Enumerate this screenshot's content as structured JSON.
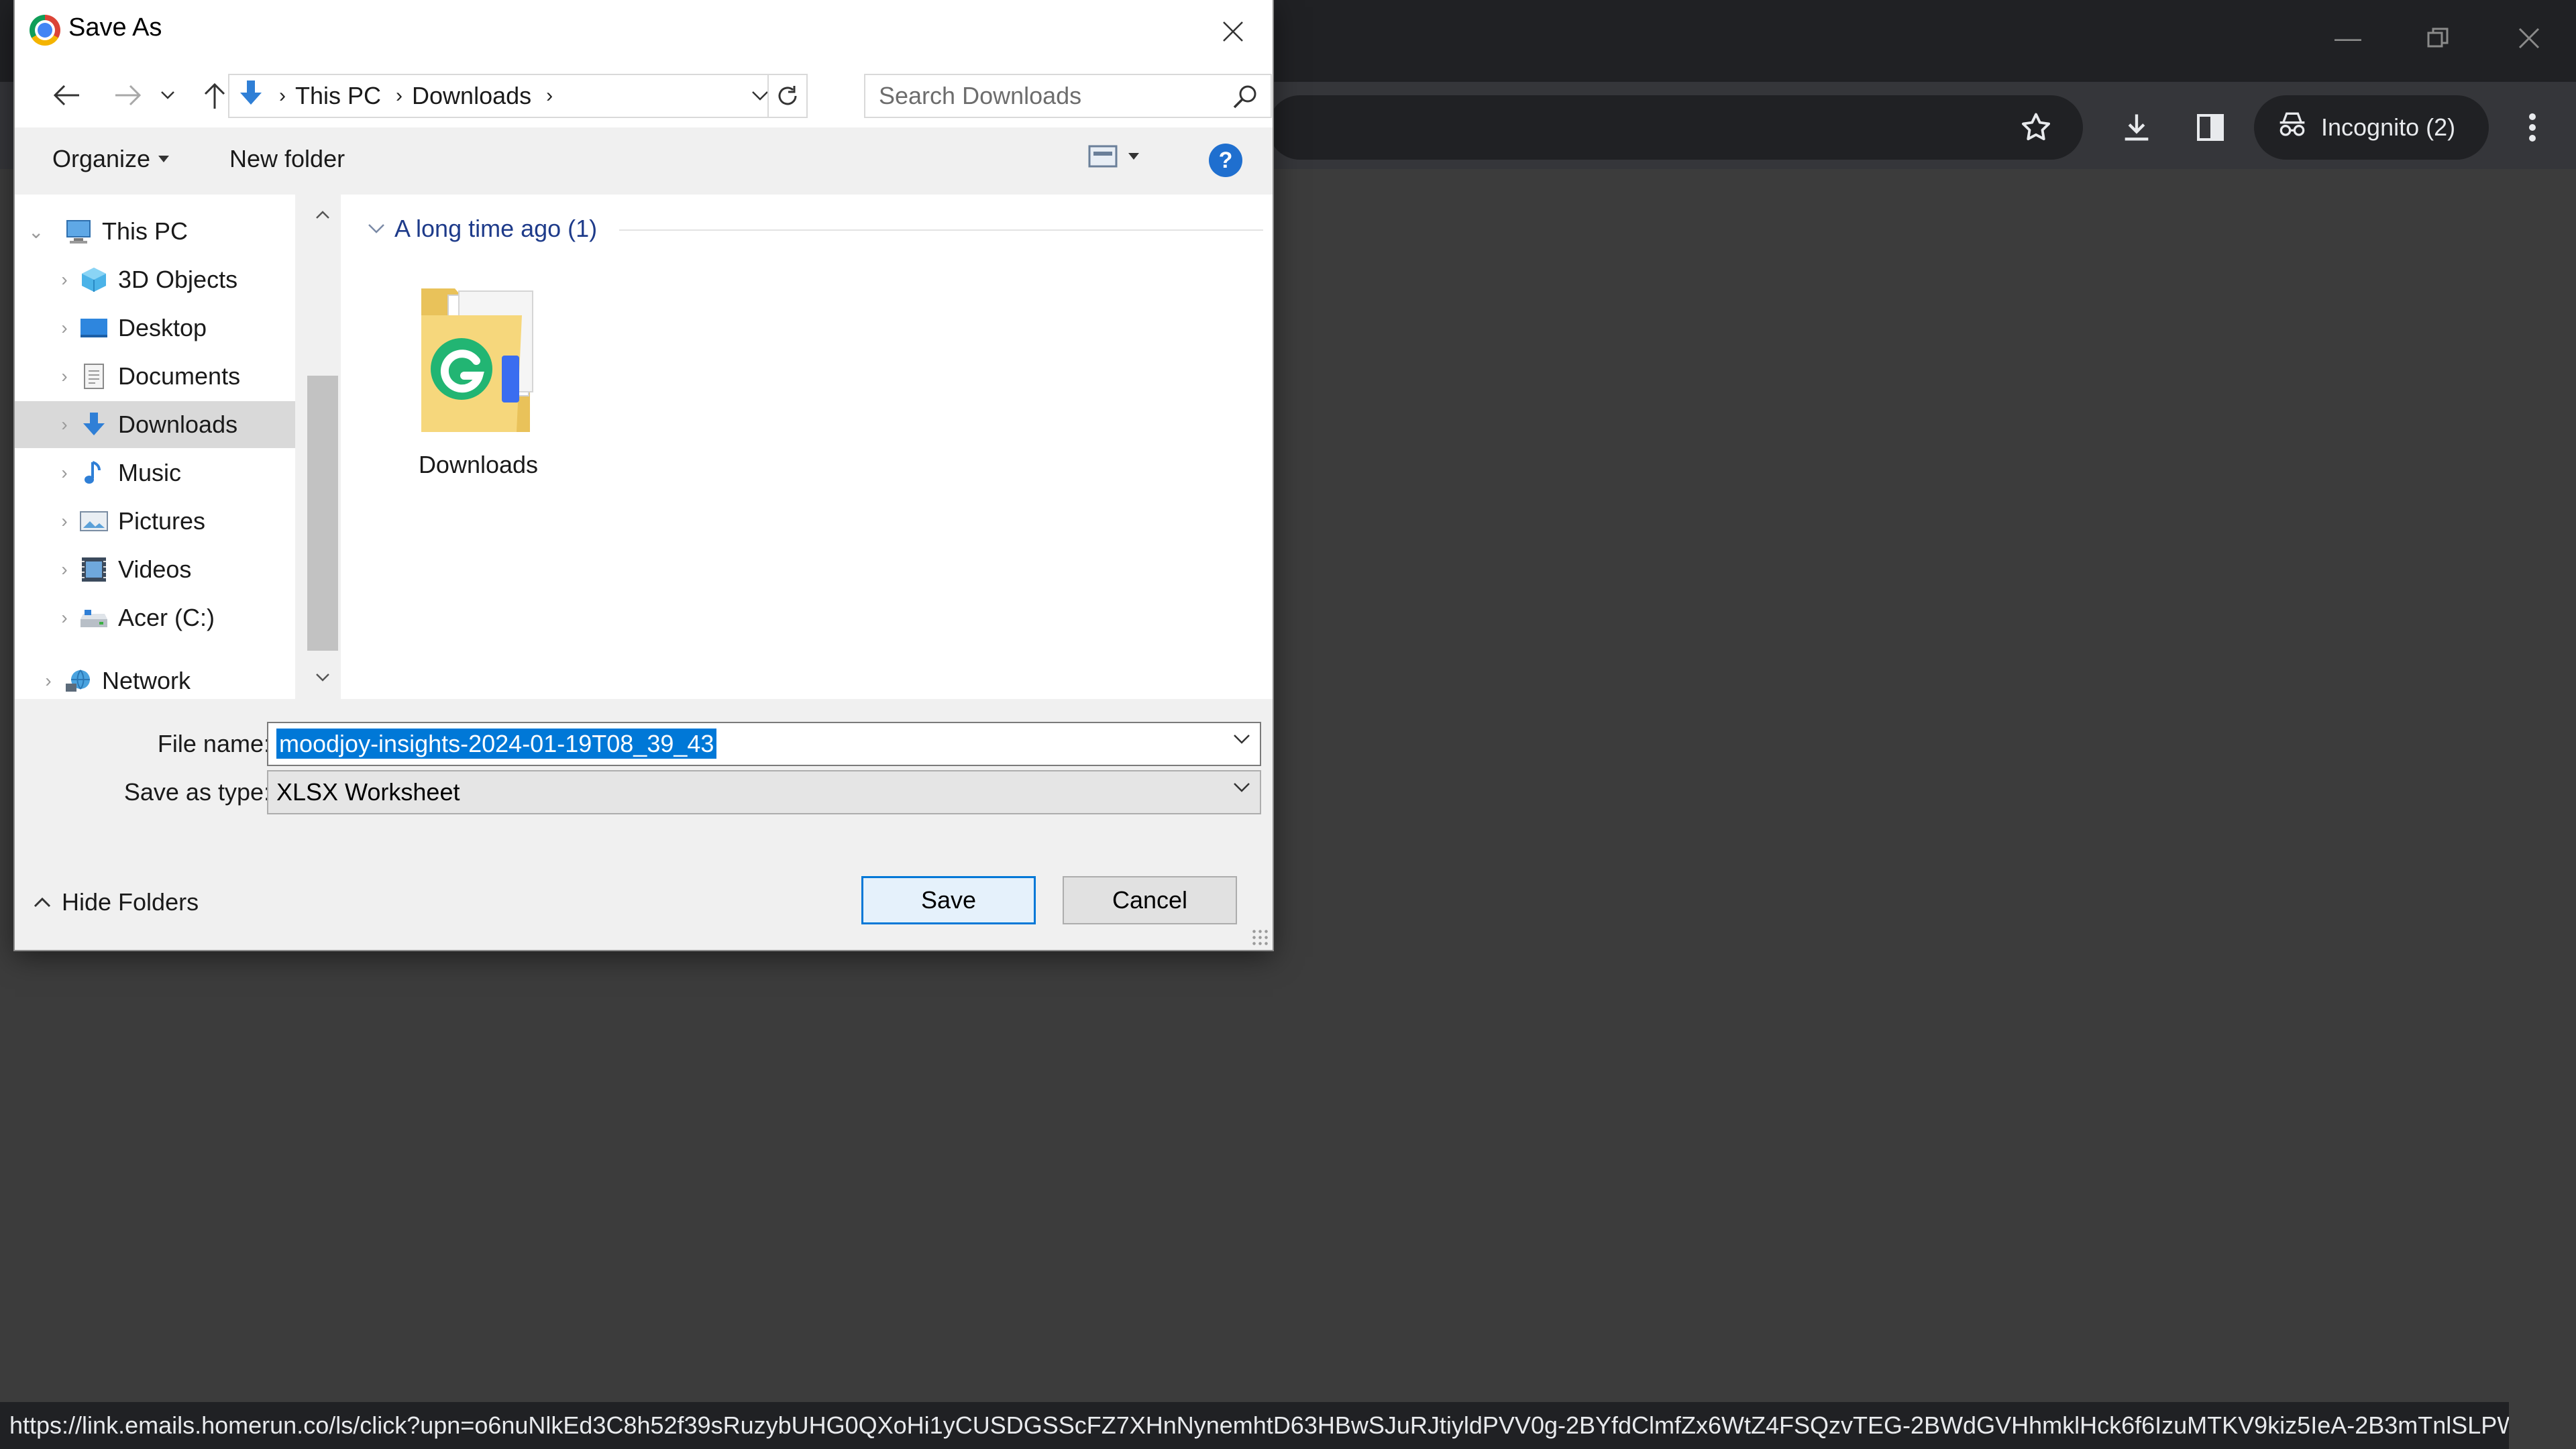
{
  "browser": {
    "incognito_label": "Incognito (2)",
    "status_url": "https://link.emails.homerun.co/ls/click?upn=o6nuNlkEd3C8h52f39sRuzybUHG0QXoHi1yCUSDGSScFZ7XHnNynemhtD63HBwSJuRJtiyldPVV0g-2BYfdClmfZx6WtZ4FSQzvTEG-2BWdGVHhmklHck6f6IzuMTKV9kiz5IeA-2B3mTnlSLPWCVSw...",
    "icons": [
      "minimize-icon",
      "restore-icon",
      "close-icon",
      "star-icon",
      "download-icon",
      "side-panel-icon",
      "incognito-icon",
      "more-icon"
    ]
  },
  "dialog": {
    "title": "Save As",
    "breadcrumb": [
      "This PC",
      "Downloads"
    ],
    "search_placeholder": "Search Downloads",
    "toolbar": {
      "organize": "Organize",
      "new_folder": "New folder",
      "help": "?"
    },
    "tree": [
      {
        "label": "This PC",
        "level": 0,
        "icon": "pc-icon"
      },
      {
        "label": "3D Objects",
        "level": 1,
        "icon": "3d-objects-icon"
      },
      {
        "label": "Desktop",
        "level": 1,
        "icon": "desktop-icon"
      },
      {
        "label": "Documents",
        "level": 1,
        "icon": "documents-icon"
      },
      {
        "label": "Downloads",
        "level": 1,
        "icon": "downloads-icon",
        "selected": true
      },
      {
        "label": "Music",
        "level": 1,
        "icon": "music-icon"
      },
      {
        "label": "Pictures",
        "level": 1,
        "icon": "pictures-icon"
      },
      {
        "label": "Videos",
        "level": 1,
        "icon": "videos-icon"
      },
      {
        "label": "Acer (C:)",
        "level": 1,
        "icon": "drive-icon"
      },
      {
        "label": "Network",
        "level": 0,
        "icon": "network-icon"
      }
    ],
    "group_header": "A long time ago (1)",
    "files": [
      {
        "label": "Downloads",
        "icon": "folder-icon"
      }
    ],
    "file_name_label": "File name:",
    "file_name_value": "moodjoy-insights-2024-01-19T08_39_43",
    "save_as_type_label": "Save as type:",
    "save_as_type_value": "XLSX Worksheet",
    "save_button": "Save",
    "cancel_button": "Cancel",
    "hide_folders": "Hide Folders"
  }
}
